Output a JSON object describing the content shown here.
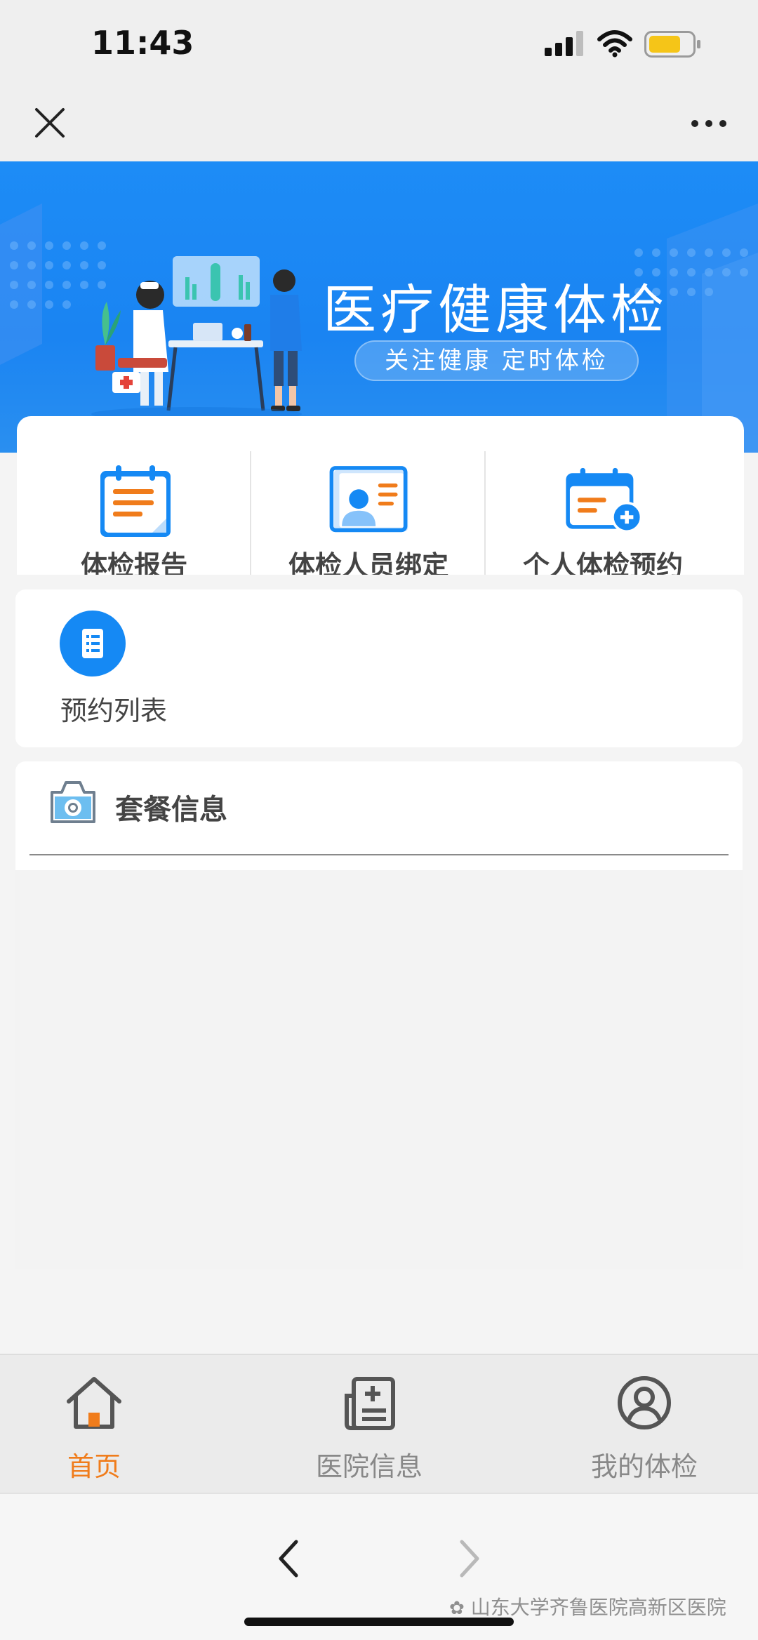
{
  "status_bar": {
    "time": "11:43"
  },
  "banner": {
    "title": "医疗健康体检",
    "subtitle": "关注健康  定时体检"
  },
  "features": [
    {
      "label": "体检报告",
      "icon": "report-icon"
    },
    {
      "label": "体检人员绑定",
      "icon": "id-card-icon"
    },
    {
      "label": "个人体检预约",
      "icon": "calendar-add-icon"
    }
  ],
  "appointment": {
    "label": "预约列表",
    "icon": "list-icon"
  },
  "package": {
    "title": "套餐信息",
    "icon": "camera-icon"
  },
  "tabbar": {
    "items": [
      {
        "label": "首页",
        "icon": "home-icon",
        "active": true
      },
      {
        "label": "医院信息",
        "icon": "news-icon",
        "active": false
      },
      {
        "label": "我的体检",
        "icon": "user-circle-icon",
        "active": false
      }
    ]
  },
  "watermark": "山东大学齐鲁医院高新区医院",
  "colors": {
    "primary": "#1589f4",
    "accent_orange": "#f07c1b",
    "banner_blue": "#1d8cf6",
    "text_dark": "#444444",
    "text_muted": "#888888"
  }
}
